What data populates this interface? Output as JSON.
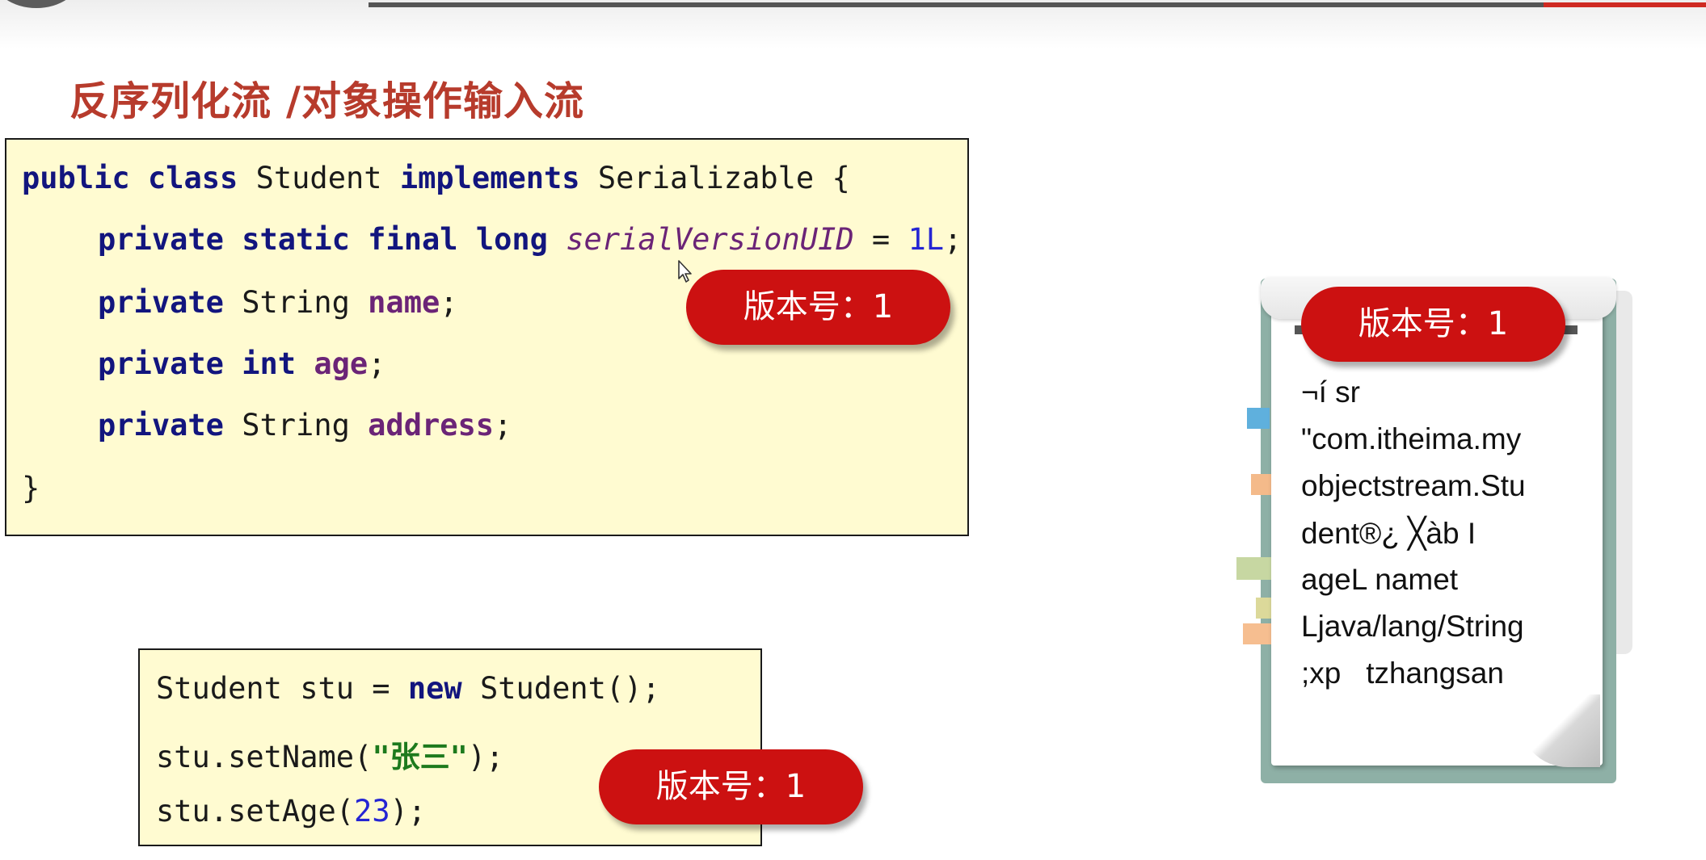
{
  "title": "反序列化流 /对象操作输入流",
  "class_code": {
    "l1": {
      "kw1": "public",
      "kw2": "class",
      "name": "Student",
      "kw3": "implements",
      "iface": "Serializable {"
    },
    "l2": {
      "kw1": "private",
      "kw2": "static",
      "kw3": "final",
      "kw4": "long",
      "const": "serialVersionUID",
      "eq": " = ",
      "num": "1L",
      "semi": ";"
    },
    "l3": {
      "kw": "private",
      "type": "String",
      "field": "name",
      "semi": ";"
    },
    "l4": {
      "kw": "private",
      "type": "int",
      "field": "age",
      "semi": ";"
    },
    "l5": {
      "kw": "private",
      "type": "String",
      "field": "address",
      "semi": ";"
    },
    "l6": "}"
  },
  "usage_code": {
    "l1": {
      "pre": "Student stu = ",
      "kw": "new",
      "post": " Student();"
    },
    "l2": {
      "pre": "stu.setName(",
      "str": "\"张三\"",
      "post": ");"
    },
    "l3": {
      "pre": "stu.setAge(",
      "num": "23",
      "post": ");"
    }
  },
  "badges": {
    "class_version": "版本号：1",
    "object_version": "版本号：1",
    "file_version": "版本号：1"
  },
  "file_content": [
    "¬í sr",
    "\"com.itheima.my",
    "objectstream.Stu",
    "dent®¿ ╳àb I",
    "ageL namet",
    "Ljava/lang/String",
    ";xp   tzhangsan"
  ],
  "colors": {
    "title": "#b73b2c",
    "keyword": "#12157e",
    "field": "#6b2477",
    "number": "#2525d3",
    "string": "#1d7a1d",
    "code_bg": "#fffbd1",
    "badge": "#cc1111"
  }
}
